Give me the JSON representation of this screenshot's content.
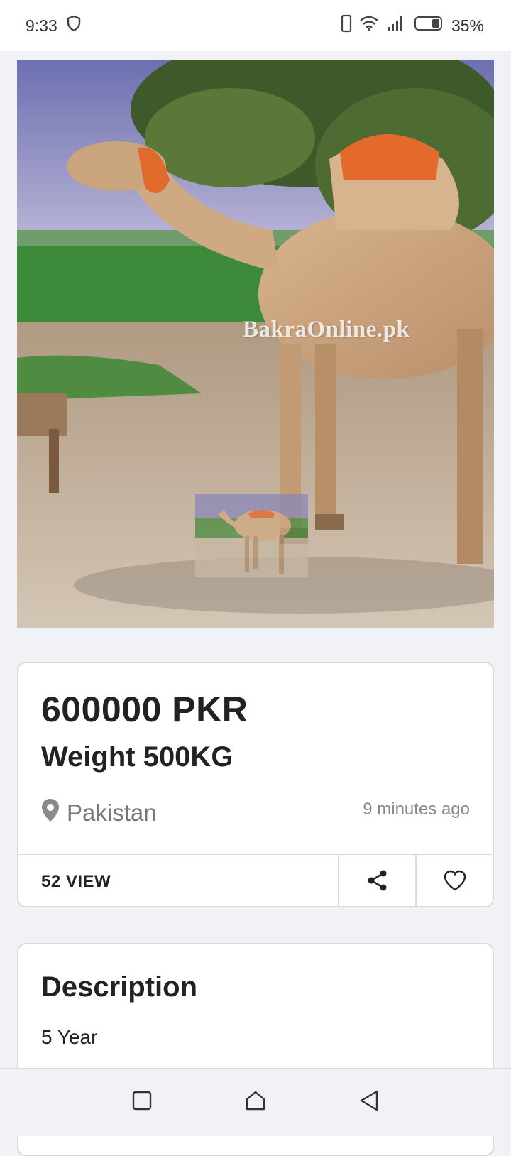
{
  "status_bar": {
    "time": "9:33",
    "battery": "35%",
    "icons": [
      "shield-icon",
      "phone-icon",
      "wifi-icon",
      "signal-icon",
      "battery-icon"
    ]
  },
  "listing": {
    "watermark": "BakraOnline.pk",
    "price": "600000 PKR",
    "title": "Weight 500KG",
    "location": "Pakistan",
    "posted": "9 minutes ago",
    "views": "52 VIEW"
  },
  "description": {
    "heading": "Description",
    "text": "5 Year"
  },
  "colors": {
    "accent": "#222222",
    "muted": "#888888",
    "card_border": "#d9d9de",
    "background": "#f1f2f6"
  }
}
